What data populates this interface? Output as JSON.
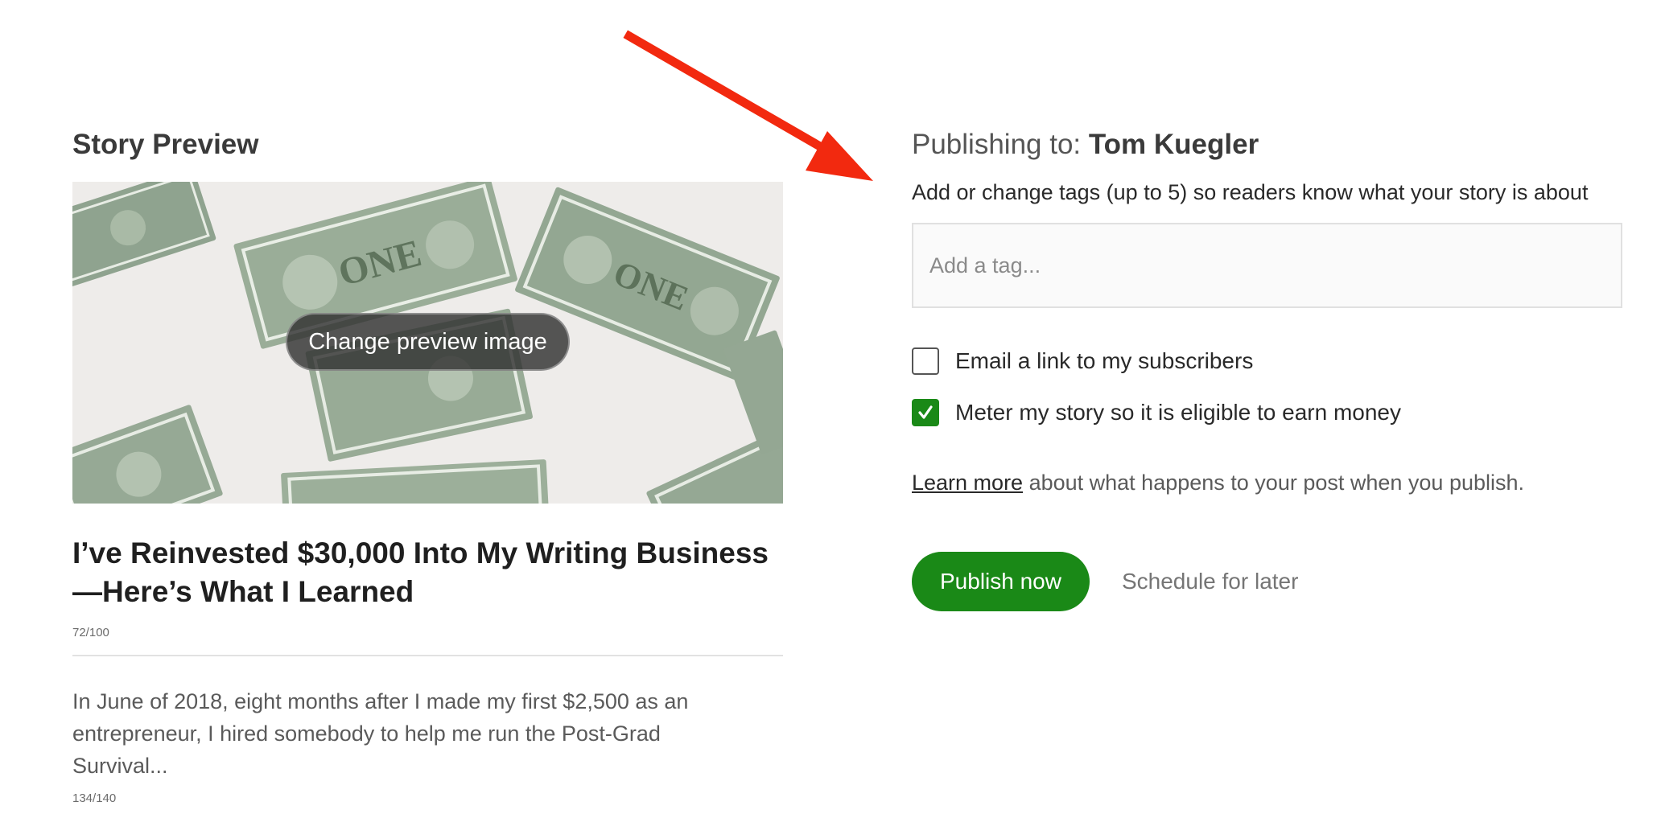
{
  "left": {
    "section_title": "Story Preview",
    "change_image_label": "Change preview image",
    "story_title": "I’ve Reinvested $30,000 Into My Writing Business—Here’s What I Learned",
    "title_counter": "72/100",
    "subtitle": "In June of 2018, eight months after I made my first $2,500 as an entrepreneur, I hired somebody to help me run the Post-Grad Survival...",
    "subtitle_counter": "134/140"
  },
  "right": {
    "publishing_prefix": "Publishing to: ",
    "publishing_name": "Tom Kuegler",
    "tags_help": "Add or change tags (up to 5) so readers know what your story is about",
    "tag_placeholder": "Add a tag...",
    "options": [
      {
        "label": "Email a link to my subscribers",
        "checked": false
      },
      {
        "label": "Meter my story so it is eligible to earn money",
        "checked": true
      }
    ],
    "learn_more_link": "Learn more",
    "learn_more_rest": " about what happens to your post when you publish.",
    "publish_label": "Publish now",
    "schedule_label": "Schedule for later"
  },
  "colors": {
    "accent_green": "#1a8917",
    "annotation_red": "#f2290f"
  },
  "icons": {
    "checkmark": "checkmark-icon",
    "arrow": "annotation-arrow"
  }
}
